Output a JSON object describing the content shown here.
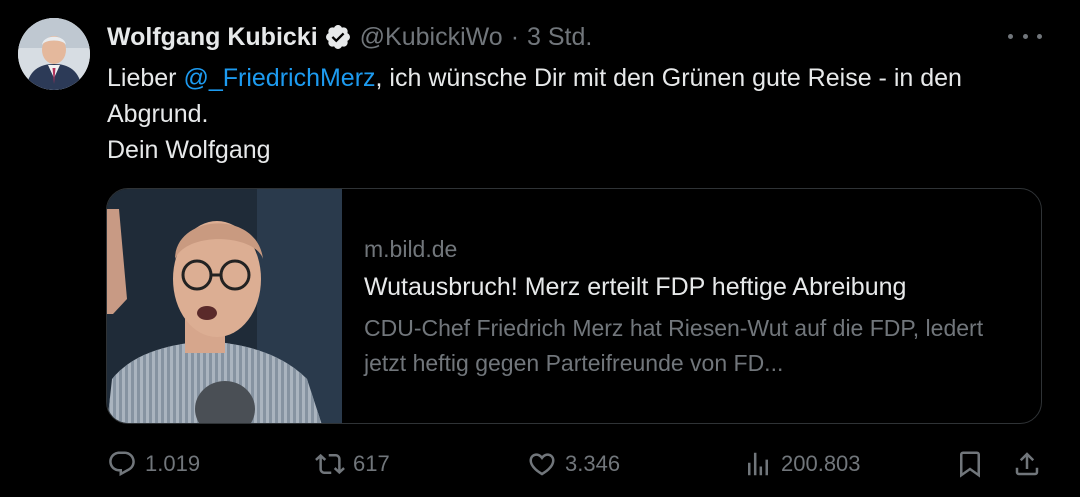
{
  "author": {
    "display_name": "Wolfgang Kubicki",
    "handle": "@KubickiWo",
    "separator": "·",
    "time": "3 Std.",
    "verified": true
  },
  "tweet": {
    "text_before": "Lieber ",
    "mention": "@_FriedrichMerz",
    "text_after": ", ich wünsche Dir mit den Grünen gute Reise - in den Abgrund.",
    "signoff": "Dein Wolfgang"
  },
  "link_card": {
    "domain": "m.bild.de",
    "title": "Wutausbruch! Merz erteilt FDP heftige Abreibung",
    "description": "CDU-Chef Friedrich Merz hat Riesen-Wut auf die FDP, ledert jetzt heftig gegen Parteifreunde von FD..."
  },
  "actions": {
    "replies": "1.019",
    "reposts": "617",
    "likes": "3.346",
    "views": "200.803"
  },
  "icons": {
    "more": "more-horizontal-icon",
    "verified": "verified-badge-icon",
    "reply": "reply-icon",
    "repost": "repost-icon",
    "like": "heart-icon",
    "views": "analytics-icon",
    "bookmark": "bookmark-icon",
    "share": "share-icon"
  },
  "colors": {
    "background": "#000000",
    "text": "#e7e9ea",
    "secondary": "#71767b",
    "link": "#1d9bf0",
    "border": "#2f3336"
  }
}
